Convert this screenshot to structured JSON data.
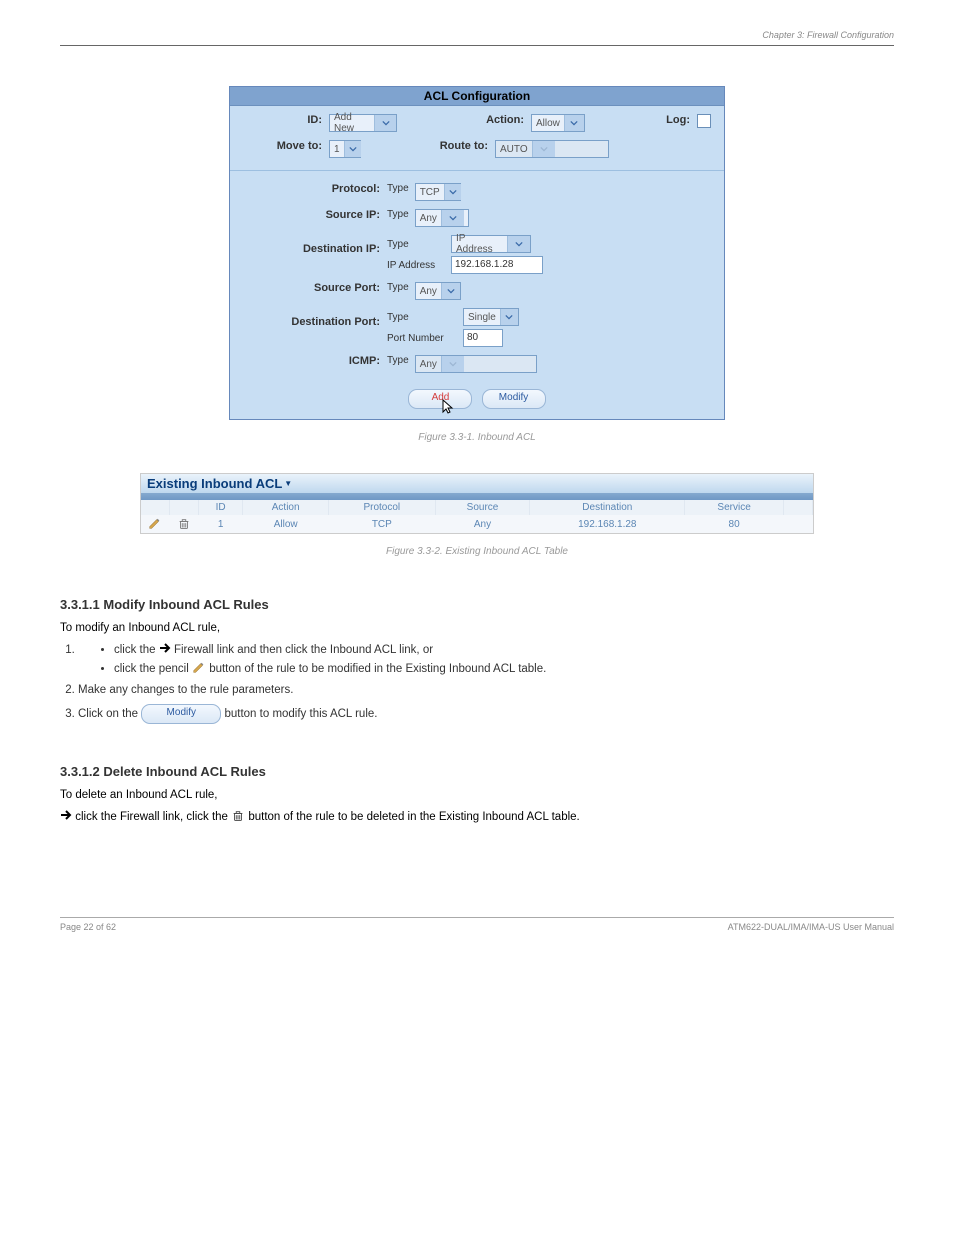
{
  "page_header_right": "Chapter 3: Firewall Configuration",
  "figure": {
    "title_bar": "ACL Configuration",
    "row1": {
      "id_label": "ID:",
      "id_value": "Add New",
      "action_label": "Action:",
      "action_value": "Allow",
      "log_label": "Log:"
    },
    "row2": {
      "move_label": "Move to:",
      "move_value": "1",
      "route_label": "Route to:",
      "route_value": "AUTO"
    },
    "protocol_label": "Protocol:",
    "type_word": "Type",
    "protocol_value": "TCP",
    "source_ip_label": "Source IP:",
    "source_ip_value": "Any",
    "dest_ip_label": "Destination IP:",
    "dest_ip_type_value": "IP Address",
    "dest_ip_addr_label": "IP Address",
    "dest_ip_addr_value": "192.168.1.28",
    "source_port_label": "Source Port:",
    "source_port_value": "Any",
    "dest_port_label": "Destination Port:",
    "dest_port_type_value": "Single",
    "dest_port_num_label": "Port Number",
    "dest_port_num_value": "80",
    "icmp_label": "ICMP:",
    "icmp_value": "Any",
    "add_btn": "Add",
    "modify_btn": "Modify",
    "caption": "Figure 3.3-1.  Inbound ACL"
  },
  "strip": {
    "title": "Existing Inbound ACL",
    "headers": [
      "",
      "",
      "ID",
      "Action",
      "Protocol",
      "Source",
      "Destination",
      "Service",
      ""
    ],
    "row": {
      "id": "1",
      "action": "Allow",
      "protocol": "TCP",
      "source": "Any",
      "destination": "192.168.1.28",
      "service": "80"
    },
    "caption": "Figure 3.3-2.  Existing Inbound ACL Table"
  },
  "sections": {
    "modify_title": "3.3.1.1 Modify Inbound ACL Rules",
    "modify_intro": "To modify an Inbound ACL rule,",
    "modify_steps": {
      "s1a": "click the ",
      "s1b": " Firewall link and then click the Inbound ACL link, or",
      "s2a": "click the pencil ",
      "s2b": " button of the rule to be modified in the Existing Inbound ACL table.",
      "s3": "Make any changes to the rule parameters.",
      "s4a": "Click on the ",
      "s4b": " button to modify this ACL rule."
    },
    "delete_title": "3.3.1.2 Delete Inbound ACL Rules",
    "delete_intro": "To delete an Inbound ACL rule,",
    "delete_s1a": " click the Firewall link, click the ",
    "delete_s1b": " button of the rule to be deleted in the Existing Inbound ACL table."
  },
  "footer": {
    "left": "Page 22 of 62",
    "right": "ATM622-DUAL/IMA/IMA-US User Manual"
  }
}
